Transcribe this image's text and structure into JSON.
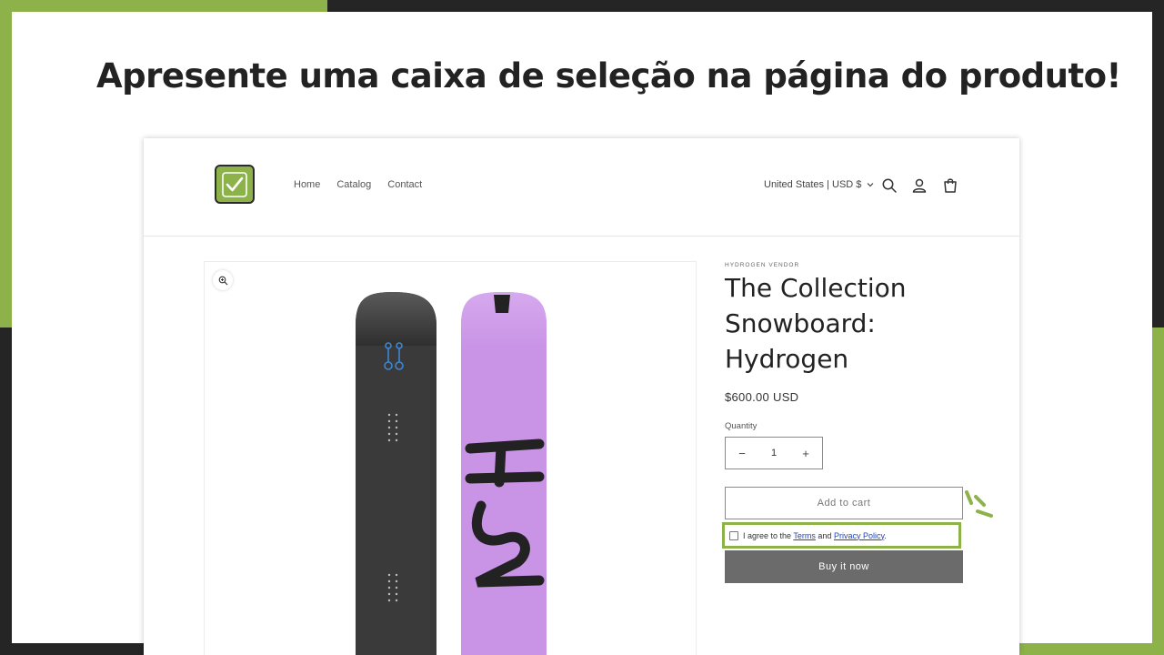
{
  "slide": {
    "headline": "Apresente uma caixa de seleção na página do produto!",
    "accent_color": "#8db24a",
    "dark_color": "#252525"
  },
  "store": {
    "logo_icon": "check-icon",
    "nav": [
      {
        "label": "Home"
      },
      {
        "label": "Catalog"
      },
      {
        "label": "Contact"
      }
    ],
    "locale": "United States | USD $",
    "header_icons": [
      "search-icon",
      "account-icon",
      "cart-icon"
    ]
  },
  "product": {
    "vendor": "HYDROGEN VENDOR",
    "title": "The Collection Snowboard: Hydrogen",
    "price": "$600.00 USD",
    "quantity_label": "Quantity",
    "quantity_value": "1",
    "decrease_symbol": "−",
    "increase_symbol": "+",
    "add_to_cart": "Add to cart",
    "agree": {
      "prefix": "I agree to the",
      "terms": "Terms",
      "and": "and",
      "privacy": "Privacy Policy",
      "suffix": "."
    },
    "buy_now": "Buy it now",
    "board_graphic": "H2"
  }
}
